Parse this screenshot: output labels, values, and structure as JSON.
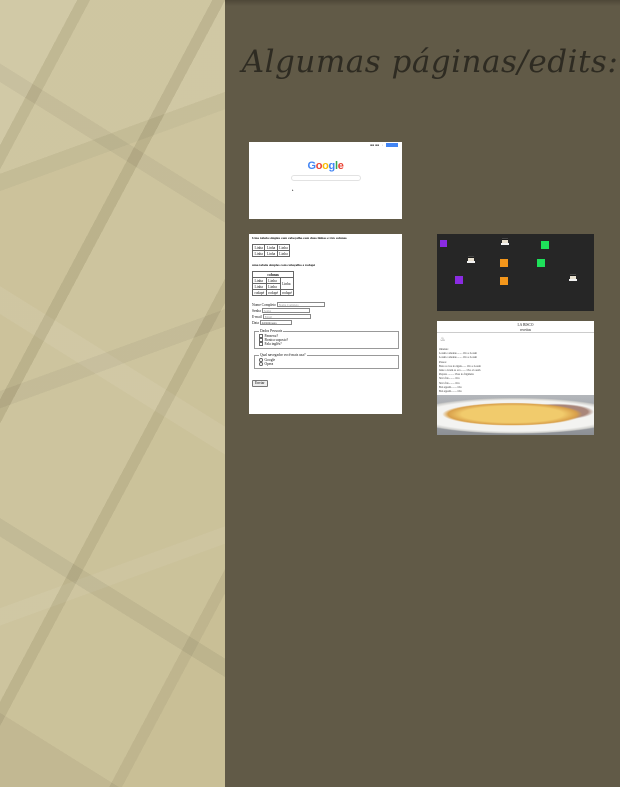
{
  "page": {
    "heading": "Algumas páginas/edits:"
  },
  "google": {
    "logo_letters": [
      {
        "ch": "G",
        "color": "#4285f4"
      },
      {
        "ch": "o",
        "color": "#ea4335"
      },
      {
        "ch": "o",
        "color": "#fbbc05"
      },
      {
        "ch": "g",
        "color": "#4285f4"
      },
      {
        "ch": "l",
        "color": "#34a853"
      },
      {
        "ch": "e",
        "color": "#ea4335"
      }
    ]
  },
  "table_page": {
    "title1": "Uma tabela simples com cabeçalho com duas linhas e três colunas",
    "table1": {
      "rows": [
        [
          "Linha",
          "Linha",
          "Linha"
        ],
        [
          "Linha",
          "Linha",
          "Linha"
        ]
      ]
    },
    "title2": "uma tabela simples com cabeçalho e rodapé",
    "table2": {
      "header": "colunas",
      "rows": [
        [
          "Linha",
          "Linha"
        ],
        [
          "Linha",
          "Linha"
        ]
      ],
      "side": "Linha",
      "footer": [
        "rodapé",
        "rodapé",
        "rodapé"
      ]
    },
    "form": {
      "name_label": "Nome Completo",
      "name_placeholder": "Nome Completo",
      "password_label": "Senha",
      "password_placeholder": "Senha",
      "email_label": "E-mail",
      "email_placeholder": "Email",
      "date_label": "Data",
      "date_value": "dd/mm/aaaa",
      "fieldset1_legend": "Dados Pessoais",
      "fieldset1_options": [
        "Pansexu?",
        "Bonica suposto?",
        "Fala inglês?"
      ],
      "fieldset2_legend": "Qual navegador você mais usa?",
      "fieldset2_options": [
        "Google",
        "Opera"
      ],
      "submit_label": "Enviar"
    }
  },
  "game": {
    "colors": {
      "purple": "#8a2be2",
      "green": "#1ee05a",
      "orange": "#f3961b"
    }
  },
  "recipe": {
    "title": "LA BISCO",
    "subtitle": "receitas",
    "lines": [
      "Omelete:",
      "Lorem e omelete......... Ovo e Lorem",
      "Lorem e omelete......... Ovo e Lorem",
      "Passos:",
      "Bata os ovos na tigela....... Ovo e Lorem",
      "Junte o lorem ao ovo........ Ovo e Lorem",
      "Prepare .......... Ovos no frigideira",
      "Sirva frio......... Ovo",
      "Sirva frio......... Ovo",
      "Bon appetit......... Ovo",
      "Bon appetit......... Ovo"
    ]
  }
}
